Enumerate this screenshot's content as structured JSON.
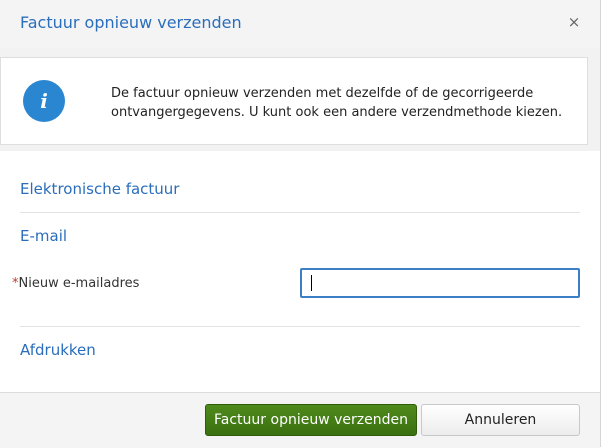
{
  "dialog": {
    "title": "Factuur opnieuw verzenden",
    "close_glyph": "×"
  },
  "info": {
    "icon": "info-icon",
    "icon_glyph": "i",
    "text": "De factuur opnieuw verzenden met dezelfde of de gecorrigeerde ontvangergegevens. U kunt ook een andere verzendmethode kiezen."
  },
  "sections": {
    "electronic": "Elektronische factuur",
    "email": "E-mail",
    "print": "Afdrukken"
  },
  "email_field": {
    "required_marker": "*",
    "label": "Nieuw e-mailadres",
    "value": "",
    "placeholder": ""
  },
  "footer": {
    "primary_label": "Factuur opnieuw verzenden",
    "cancel_label": "Annuleren"
  },
  "colors": {
    "accent": "#2a6ebb",
    "info_icon": "#2b86d2",
    "primary_button": "#3f7a14",
    "required": "#c0392b"
  }
}
